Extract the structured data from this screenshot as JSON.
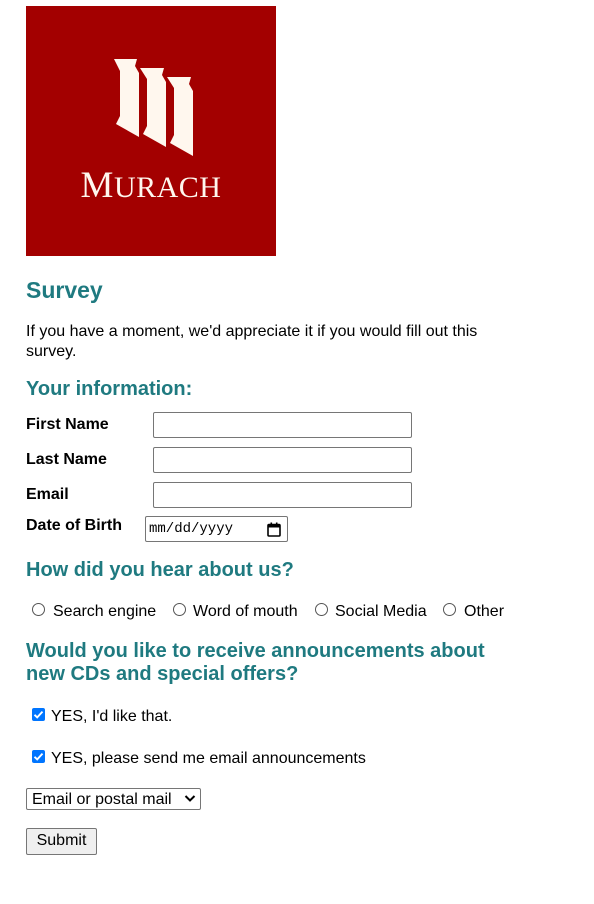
{
  "logo": {
    "brand_text": "MURACH",
    "background_color": "#a30000",
    "mark_color": "#fff7ee"
  },
  "page_title": "Survey",
  "intro_text": "If you have a moment, we'd appreciate it if you would fill out this survey.",
  "info_section": {
    "heading": "Your information:",
    "fields": {
      "first_name": {
        "label": "First Name",
        "value": ""
      },
      "last_name": {
        "label": "Last Name",
        "value": ""
      },
      "email": {
        "label": "Email",
        "value": ""
      },
      "dob": {
        "label": "Date of Birth",
        "placeholder": "mm/dd/yyyy",
        "icon": "calendar-icon"
      }
    }
  },
  "heard_section": {
    "heading": "How did you hear about us?",
    "options": [
      {
        "label": "Search engine",
        "selected": false
      },
      {
        "label": "Word of mouth",
        "selected": false
      },
      {
        "label": "Social Media",
        "selected": false
      },
      {
        "label": "Other",
        "selected": false
      }
    ]
  },
  "announce_section": {
    "heading_line1": "Would you like to receive announcements about",
    "heading_line2": "new CDs and special offers?",
    "checkboxes": [
      {
        "label": "YES, I'd like that.",
        "checked": true
      },
      {
        "label": "YES, please send me email announcements",
        "checked": true
      }
    ],
    "contact_select": {
      "selected": "Email or postal mail"
    }
  },
  "submit_label": "Submit",
  "colors": {
    "heading": "#1f7a80",
    "checkbox_accent": "#0075ff"
  }
}
